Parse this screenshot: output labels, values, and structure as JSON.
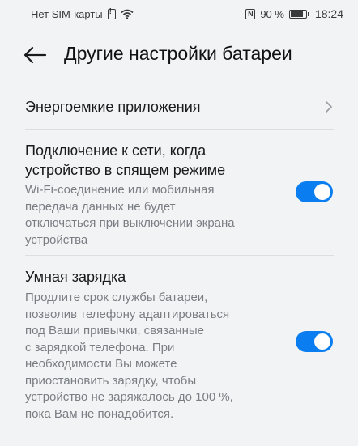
{
  "status_bar": {
    "carrier": "Нет SIM-карты",
    "battery_percent": "90 %",
    "battery_level": 0.9,
    "time": "18:24",
    "icons": [
      "sim-icon",
      "wifi-icon",
      "nfc-icon",
      "battery-icon"
    ]
  },
  "header": {
    "title": "Другие настройки батареи"
  },
  "items": {
    "energy_apps": {
      "label": "Энергоемкие приложения"
    },
    "network_sleep": {
      "title_line1": "Подключение к сети, когда",
      "title_line2": "устройство в спящем режиме",
      "desc_line1": "Wi-Fi-соединение или мобильная",
      "desc_line2": "передача данных не будет",
      "desc_line3": "отключаться при выключении экрана",
      "desc_line4": "устройства",
      "enabled": true
    },
    "smart_charging": {
      "title": "Умная зарядка",
      "desc_line1": "Продлите срок службы батареи,",
      "desc_line2": "позволив телефону адаптироваться",
      "desc_line3": "под Ваши привычки, связанные",
      "desc_line4": "с зарядкой телефона. При",
      "desc_line5": "необходимости Вы можете",
      "desc_line6": "приостановить зарядку, чтобы",
      "desc_line7": "устройство не заряжалось до 100 %,",
      "desc_line8": "пока Вам не понадобится.",
      "enabled": true
    }
  },
  "colors": {
    "accent": "#0a7ef0",
    "background": "#f1f3f5",
    "secondary_text": "#7a7e83"
  }
}
